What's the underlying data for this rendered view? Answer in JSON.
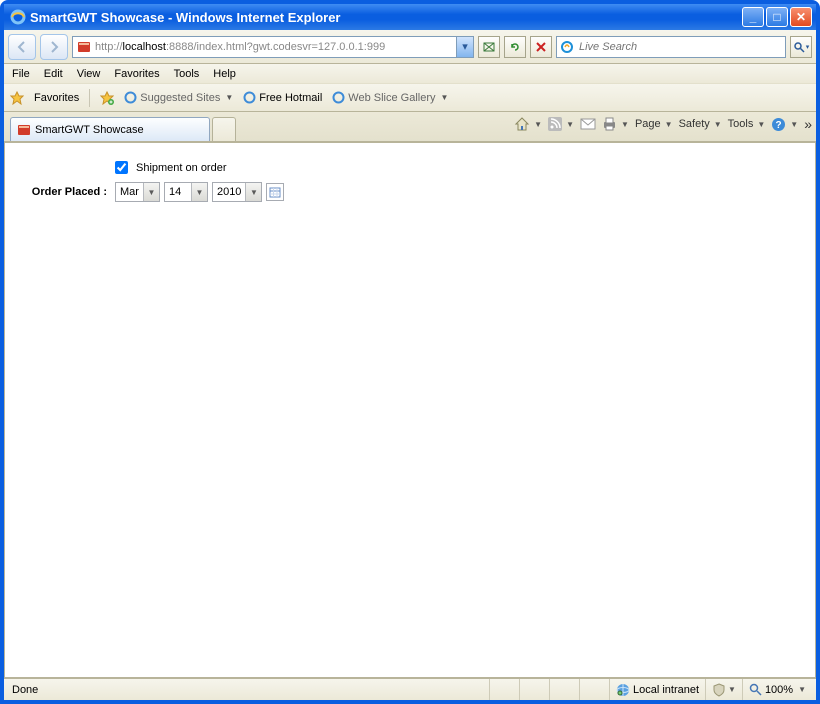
{
  "window": {
    "title": "SmartGWT Showcase - Windows Internet Explorer"
  },
  "address": {
    "url": "http://localhost:8888/index.html?gwt.codesvr=127.0.0.1:999",
    "host_prefix": "http://",
    "host": "localhost",
    "rest": ":8888/index.html?gwt.codesvr=127.0.0.1:999"
  },
  "search": {
    "placeholder": "Live Search"
  },
  "menubar": {
    "file": "File",
    "edit": "Edit",
    "view": "View",
    "favorites": "Favorites",
    "tools": "Tools",
    "help": "Help"
  },
  "favbar": {
    "favorites": "Favorites",
    "suggested": "Suggested Sites",
    "hotmail": "Free Hotmail",
    "webslice": "Web Slice Gallery"
  },
  "tab": {
    "title": "SmartGWT Showcase"
  },
  "cmd": {
    "page": "Page",
    "safety": "Safety",
    "tools": "Tools"
  },
  "form": {
    "shipment_label": "Shipment on order",
    "shipment_checked": true,
    "order_label": "Order Placed :",
    "month": "Mar",
    "day": "14",
    "year": "2010"
  },
  "status": {
    "done": "Done",
    "zone": "Local intranet",
    "zoom": "100%"
  }
}
